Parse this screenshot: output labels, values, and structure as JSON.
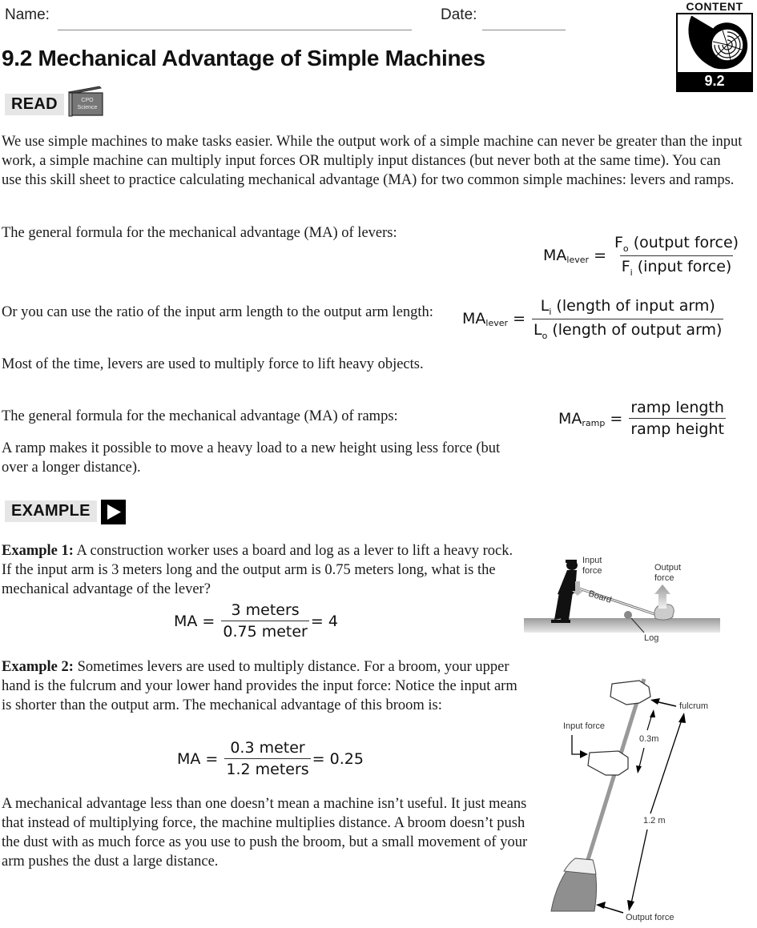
{
  "header": {
    "name_label": "Name:",
    "date_label": "Date:",
    "title": "9.2 Mechanical Advantage of Simple Machines"
  },
  "badge": {
    "label": "CONTENT",
    "section_number": "9.2",
    "icon": "nautilus-shell-icon"
  },
  "read_tag": {
    "label": "READ",
    "book_title_line1": "CPO",
    "book_title_line2": "Science",
    "icon": "book-icon"
  },
  "intro": {
    "paragraph": "We use simple machines to make tasks easier. While the output work of a simple machine can never be greater than the input work, a simple machine can multiply input forces OR multiply input distances (but never both at the same time). You can use this skill sheet to practice calculating mechanical advantage (MA) for two common simple machines: levers and ramps."
  },
  "levers": {
    "formula_intro": "The general formula for the mechanical advantage (MA) of levers:",
    "formula1": {
      "lhs": "MA",
      "lhs_sub": "lever",
      "equals": "=",
      "numerator_symbol": "F",
      "numerator_sub": "o",
      "numerator_text": " (output force)",
      "denominator_symbol": "F",
      "denominator_sub": "i",
      "denominator_text": " (input force)"
    },
    "ratio_intro": "Or you can use the ratio of the input arm length to the output arm length:",
    "formula2": {
      "lhs": "MA",
      "lhs_sub": "lever",
      "equals": "=",
      "numerator_symbol": "L",
      "numerator_sub": "i",
      "numerator_text": " (length of input arm)",
      "denominator_symbol": "L",
      "denominator_sub": "o",
      "denominator_text": " (length of output arm)"
    },
    "note": "Most of the time, levers are used to multiply force to lift heavy objects."
  },
  "ramps": {
    "formula_intro": "The general formula for the mechanical advantage (MA) of ramps:",
    "formula": {
      "lhs": "MA",
      "lhs_sub": "ramp",
      "equals": "=",
      "numerator": "ramp length",
      "denominator": "ramp height"
    },
    "note": "A ramp makes it possible to move a heavy load to a new height using less force (but over a longer distance)."
  },
  "example_tag": {
    "label": "EXAMPLE",
    "icon": "play-arrow-icon"
  },
  "example1": {
    "label": "Example 1:",
    "text": " A construction worker uses a board and log as a lever to lift a heavy rock. If the input arm is 3 meters long and the output arm is 0.75 meters long, what is the mechanical advantage of the lever?",
    "formula": {
      "lhs": "MA =",
      "numerator": "3 meters",
      "denominator": "0.75 meter",
      "result": "= 4"
    },
    "diagram": {
      "input_force_line1": "Input",
      "input_force_line2": "force",
      "output_force_line1": "Output",
      "output_force_line2": "force",
      "board_label": "Board",
      "log_label": "Log"
    }
  },
  "example2": {
    "label": "Example 2:",
    "text": " Sometimes levers are used to multiply distance. For a broom, your upper hand is the fulcrum and your lower hand provides the input force: Notice the input arm is shorter than the output arm. The mechanical advantage of this broom is:",
    "formula": {
      "lhs": "MA =",
      "numerator": "0.3 meter",
      "denominator": "1.2 meters",
      "result": "= 0.25"
    },
    "diagram": {
      "fulcrum_label": "fulcrum",
      "input_force_label": "Input force",
      "short_length_label": "0.3m",
      "long_length_label": "1.2 m",
      "output_force_label": "Output force"
    }
  },
  "closing": {
    "paragraph": "A mechanical advantage less than one doesn’t mean a machine isn’t useful. It just means that instead of multiplying force, the machine multiplies distance. A broom doesn’t push the dust with as much force as you use to push the broom, but a small movement of your arm pushes the dust a large distance."
  }
}
